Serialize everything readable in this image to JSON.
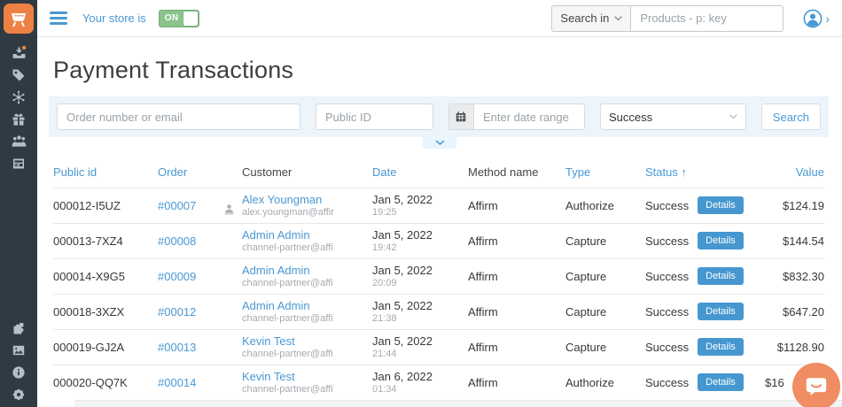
{
  "topbar": {
    "store_label": "Your store is",
    "store_toggle": "ON",
    "search_in_label": "Search in",
    "search_placeholder": "Products - p: key"
  },
  "sidebar": {
    "top_icons": [
      "orders",
      "products",
      "promotions",
      "gift-certificates",
      "customers",
      "website"
    ],
    "bottom_icons": [
      "addons",
      "design",
      "administration",
      "settings"
    ]
  },
  "page": {
    "title": "Payment Transactions"
  },
  "filters": {
    "order_placeholder": "Order number or email",
    "public_id_placeholder": "Public ID",
    "date_placeholder": "Enter date range",
    "status_value": "Success",
    "search_button": "Search"
  },
  "table": {
    "headers": [
      "Public id",
      "Order",
      "Customer",
      "Date",
      "Method name",
      "Type",
      "Status ↑",
      "Value"
    ],
    "details_label": "Details",
    "rows": [
      {
        "public_id": "000012-I5UZ",
        "order": "#00007",
        "customer": "Alex Youngman",
        "email": "alex.youngman@affir",
        "date": "Jan 5, 2022",
        "time": "19:25",
        "method": "Affirm",
        "type": "Authorize",
        "status": "Success",
        "value": "$124.19",
        "has_user_icon": true
      },
      {
        "public_id": "000013-7XZ4",
        "order": "#00008",
        "customer": "Admin Admin",
        "email": "channel-partner@affi",
        "date": "Jan 5, 2022",
        "time": "19:42",
        "method": "Affirm",
        "type": "Capture",
        "status": "Success",
        "value": "$144.54",
        "has_user_icon": false
      },
      {
        "public_id": "000014-X9G5",
        "order": "#00009",
        "customer": "Admin Admin",
        "email": "channel-partner@affi",
        "date": "Jan 5, 2022",
        "time": "20:09",
        "method": "Affirm",
        "type": "Capture",
        "status": "Success",
        "value": "$832.30",
        "has_user_icon": false
      },
      {
        "public_id": "000018-3XZX",
        "order": "#00012",
        "customer": "Admin Admin",
        "email": "channel-partner@affi",
        "date": "Jan 5, 2022",
        "time": "21:38",
        "method": "Affirm",
        "type": "Capture",
        "status": "Success",
        "value": "$647.20",
        "has_user_icon": false
      },
      {
        "public_id": "000019-GJ2A",
        "order": "#00013",
        "customer": "Kevin Test",
        "email": "channel-partner@affi",
        "date": "Jan 5, 2022",
        "time": "21:44",
        "method": "Affirm",
        "type": "Capture",
        "status": "Success",
        "value": "$1128.90",
        "has_user_icon": false
      },
      {
        "public_id": "000020-QQ7K",
        "order": "#00014",
        "customer": "Kevin Test",
        "email": "channel-partner@affi",
        "date": "Jan 6, 2022",
        "time": "01:34",
        "method": "Affirm",
        "type": "Authorize",
        "status": "Success",
        "value": "$16",
        "has_user_icon": false
      }
    ]
  },
  "colors": {
    "accent_blue": "#4a98d3",
    "sidebar_bg": "#303a42",
    "logo_orange": "#ee8145",
    "toggle_green": "#8ac48c",
    "filter_panel_bg": "#edf5fb",
    "details_button_bg": "#4697d0",
    "chat_launcher_orange": "#f08d62"
  }
}
